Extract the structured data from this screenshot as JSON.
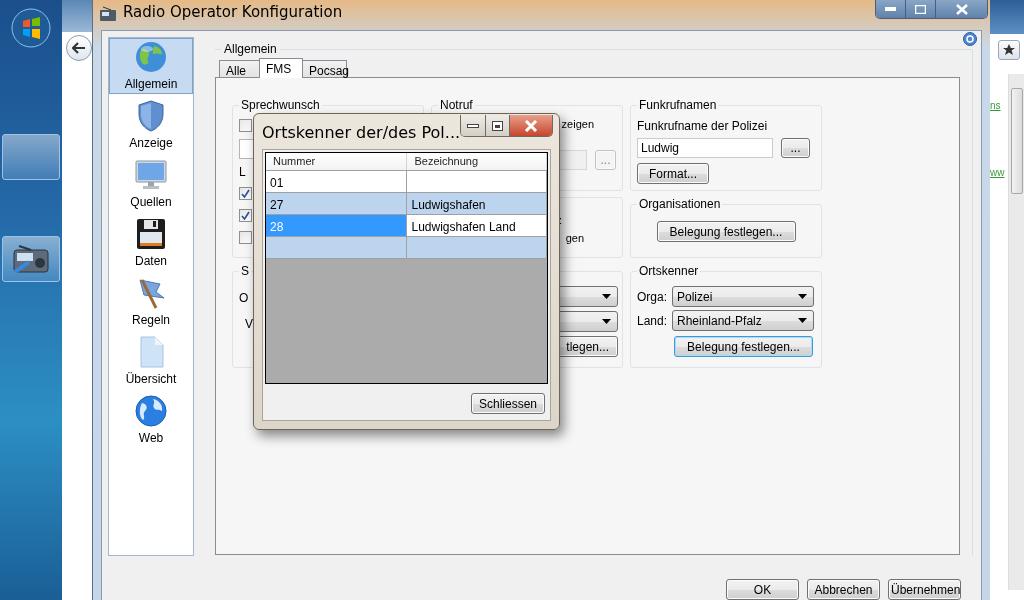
{
  "browser": {
    "links": [
      "ns",
      "ww"
    ]
  },
  "window": {
    "title": "Radio Operator Konfiguration"
  },
  "sidebar": {
    "items": [
      {
        "label": "Allgemein",
        "kind": "globe",
        "selected": true
      },
      {
        "label": "Anzeige",
        "kind": "shield",
        "selected": false
      },
      {
        "label": "Quellen",
        "kind": "monitor",
        "selected": false
      },
      {
        "label": "Daten",
        "kind": "floppy",
        "selected": false
      },
      {
        "label": "Regeln",
        "kind": "flag",
        "selected": false
      },
      {
        "label": "Übersicht",
        "kind": "document",
        "selected": false
      },
      {
        "label": "Web",
        "kind": "web",
        "selected": false
      }
    ]
  },
  "settings_group": {
    "title": "Allgemein"
  },
  "tabs": [
    {
      "label": "Alle",
      "selected": false
    },
    {
      "label": "FMS",
      "selected": true
    },
    {
      "label": "Pocsag",
      "selected": false
    }
  ],
  "sprechwunsch": {
    "title": "Sprechwunsch",
    "rows": [
      {
        "kind": "checkbox",
        "checked": false
      },
      {
        "kind": "field"
      },
      {
        "kind": "label",
        "text": "L"
      },
      {
        "kind": "checkbox",
        "checked": true
      },
      {
        "kind": "checkbox",
        "checked": true
      },
      {
        "kind": "checkbox",
        "checked": false
      }
    ]
  },
  "notruf": {
    "title": "Notruf",
    "text_fragment": "zeigen",
    "browse_button": "..."
  },
  "group_4": {
    "fragments": [
      ":",
      "gen"
    ]
  },
  "group_5": {
    "title_fragment": "S",
    "labels": [
      "O",
      "V"
    ],
    "button_fragment": "tlegen..."
  },
  "funkrufnamen": {
    "title": "Funkrufnamen",
    "label": "Funkrufname der Polizei",
    "value": "Ludwig",
    "browse_button": "...",
    "format_button": "Format..."
  },
  "organisationen": {
    "title": "Organisationen",
    "button": "Belegung festlegen..."
  },
  "ortskenner": {
    "title": "Ortskenner",
    "fields": [
      {
        "label": "Orga:",
        "value": "Polizei"
      },
      {
        "label": "Land:",
        "value": "Rheinland-Pfalz"
      }
    ],
    "button": "Belegung festlegen...",
    "button_focused": true
  },
  "buttons": [
    "OK",
    "Abbrechen",
    "Übernehmen"
  ],
  "dialog": {
    "title": "Ortskenner der/des Pol...",
    "columns": [
      "Nummer",
      "Bezeichnung"
    ],
    "rows": [
      {
        "nummer": "01",
        "selected": false
      },
      {
        "nummer": "27",
        "bezeichnung": "Ludwigshafen",
        "selected": false
      },
      {
        "nummer": "28",
        "bezeichnung": "Ludwigshafen Land",
        "selected": true
      }
    ],
    "button": "Schliessen"
  }
}
